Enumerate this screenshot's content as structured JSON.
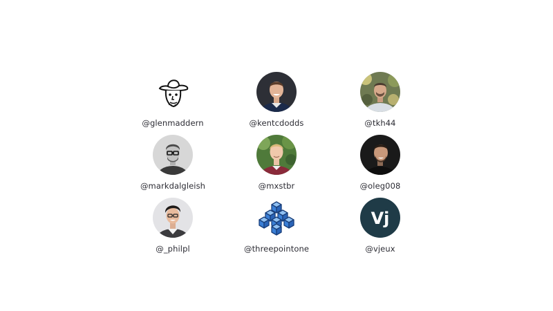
{
  "contributors": [
    {
      "handle": "@glenmaddern",
      "avatar_icon": "sketch-hat-portrait-icon"
    },
    {
      "handle": "@kentcdodds",
      "avatar_icon": "photo-portrait-icon"
    },
    {
      "handle": "@tkh44",
      "avatar_icon": "photo-portrait-icon"
    },
    {
      "handle": "@markdalgleish",
      "avatar_icon": "photo-portrait-icon"
    },
    {
      "handle": "@mxstbr",
      "avatar_icon": "photo-portrait-icon"
    },
    {
      "handle": "@oleg008",
      "avatar_icon": "photo-portrait-icon"
    },
    {
      "handle": "@_philpl",
      "avatar_icon": "photo-portrait-icon"
    },
    {
      "handle": "@threepointone",
      "avatar_icon": "blue-cubes-icon"
    },
    {
      "handle": "@vjeux",
      "avatar_icon": "vj-monogram-icon",
      "avatar_text": "Vj"
    }
  ],
  "colors": {
    "handle_text": "#2b2b33",
    "vjeux_bg": "#1f3b47",
    "cube_blue": "#3a7fd6"
  }
}
